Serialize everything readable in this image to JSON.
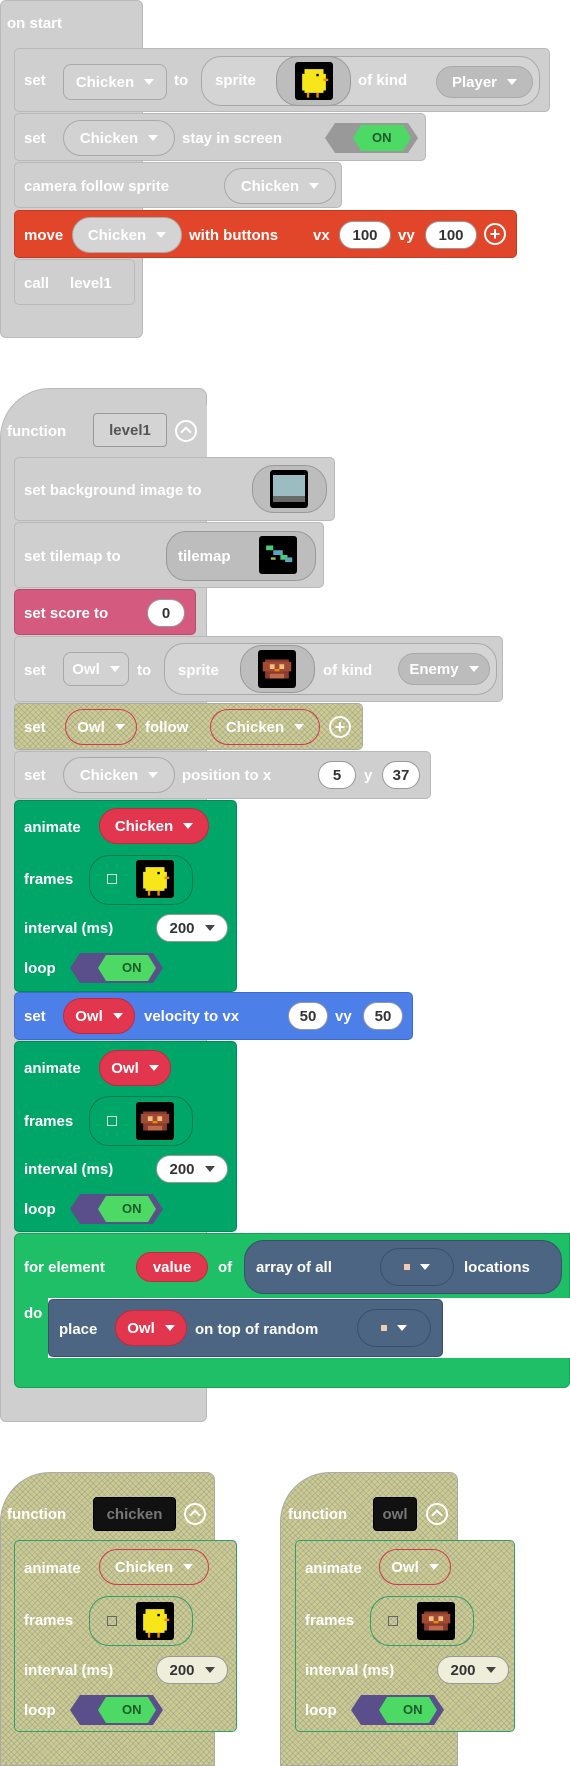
{
  "colors": {
    "grey": "#cfcfcf",
    "orange": "#e2462a",
    "pink": "#d45b7f",
    "green": "#00a568",
    "blue": "#4d7fe8",
    "loopgreen": "#1fbf68",
    "slate": "#4b6582",
    "red": "#e2364e",
    "hatch": "#cfcb8c"
  },
  "on_start": {
    "title": "on start",
    "set1": {
      "set": "set",
      "var": "Chicken",
      "to": "to",
      "sprite": "sprite",
      "of_kind": "of kind",
      "kind": "Player"
    },
    "set2": {
      "set": "set",
      "var": "Chicken",
      "stay": "stay in screen",
      "toggle": "ON"
    },
    "camera": {
      "label": "camera follow sprite",
      "var": "Chicken"
    },
    "move": {
      "move": "move",
      "var": "Chicken",
      "with_buttons": "with buttons",
      "vx": "vx",
      "vx_val": "100",
      "vy": "vy",
      "vy_val": "100"
    },
    "call": {
      "call": "call",
      "name": "level1"
    }
  },
  "level1": {
    "function": "function",
    "name": "level1",
    "bg": {
      "label": "set background image to"
    },
    "tilemap": {
      "label": "set tilemap to",
      "value": "tilemap"
    },
    "score": {
      "label": "set score to",
      "value": "0"
    },
    "owl": {
      "set": "set",
      "var": "Owl",
      "to": "to",
      "sprite": "sprite",
      "of_kind": "of kind",
      "kind": "Enemy"
    },
    "follow": {
      "set": "set",
      "var": "Owl",
      "follow": "follow",
      "target": "Chicken"
    },
    "pos": {
      "set": "set",
      "var": "Chicken",
      "position": "position to x",
      "x": "5",
      "y_label": "y",
      "y": "37"
    },
    "anim1": {
      "animate": "animate",
      "var": "Chicken",
      "frames": "frames",
      "interval": "interval (ms)",
      "interval_val": "200",
      "loop": "loop",
      "toggle": "ON"
    },
    "vel": {
      "set": "set",
      "var": "Owl",
      "velocity": "velocity to vx",
      "vx": "50",
      "vy_label": "vy",
      "vy": "50"
    },
    "anim2": {
      "animate": "animate",
      "var": "Owl",
      "frames": "frames",
      "interval": "interval (ms)",
      "interval_val": "200",
      "loop": "loop",
      "toggle": "ON"
    },
    "for": {
      "for_element": "for element",
      "value": "value",
      "of": "of",
      "array": "array of all",
      "locations": "locations",
      "do": "do"
    },
    "place": {
      "place": "place",
      "var": "Owl",
      "top": "on top of random"
    }
  },
  "fn_chicken": {
    "function": "function",
    "name": "chicken",
    "animate": "animate",
    "var": "Chicken",
    "frames": "frames",
    "interval": "interval (ms)",
    "interval_val": "200",
    "loop": "loop",
    "toggle": "ON"
  },
  "fn_owl": {
    "function": "function",
    "name": "owl",
    "animate": "animate",
    "var": "Owl",
    "frames": "frames",
    "interval": "interval (ms)",
    "interval_val": "200",
    "loop": "loop",
    "toggle": "ON"
  }
}
